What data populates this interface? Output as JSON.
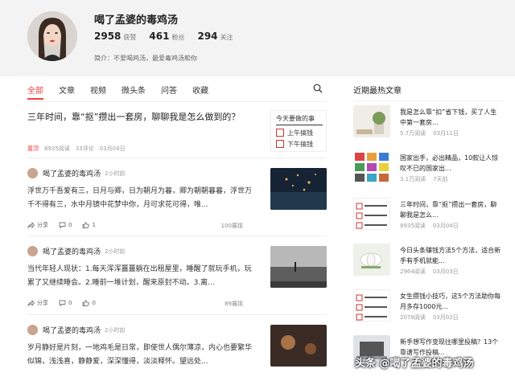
{
  "profile": {
    "name": "喝了孟婆的毒鸡汤",
    "likes": "2958",
    "likes_label": "获赞",
    "fans": "461",
    "fans_label": "粉丝",
    "follow": "294",
    "follow_label": "关注",
    "intro": "简介：不爱喝鸡汤，最爱毒鸡汤和你"
  },
  "tabs": [
    "全部",
    "文章",
    "视频",
    "微头条",
    "问答",
    "收藏"
  ],
  "feed": {
    "article": {
      "title": "三年时间，靠“抠”攒出一套房，聊聊我是怎么做到的？",
      "tag": "置顶",
      "reads": "8935阅读",
      "comments": "33评论",
      "date": "03月04日",
      "thumb_caption": "今天要做的事",
      "thumb_line1": "上午搞钱",
      "thumb_line2": "下午搞钱"
    },
    "posts": [
      {
        "author": "喝了孟婆的毒鸡汤",
        "time": "2小时前",
        "text": "浮世万千吾爱有三，日月与卿，日为朝月为暮，卿为朝朝暮暮，浮世万千不得有三，水中月镜中花梦中你，月可求花可得，唯...",
        "share": "分享",
        "comments": "0",
        "likes": "1",
        "views": "100展现"
      },
      {
        "author": "喝了孟婆的毒鸡汤",
        "time": "2小时前",
        "text": "当代年轻人现状：1.每天浑浑噩噩躺在出租屋里，睡醒了就玩手机，玩累了又继续睡会。2.睡前一堆计划，醒来原封不动。3.离...",
        "share": "分享",
        "comments": "0",
        "likes": "0",
        "views": "89展现"
      },
      {
        "author": "喝了孟婆的毒鸡汤",
        "time": "2小时前",
        "text": "岁月静好是片刻，一地鸡毛是日常，即使世人偶尔薄凉，内心也要繁华似锦，浅浅喜，静静爱，深深懂得，淡淡释怀。望远处..."
      }
    ]
  },
  "sidebar": {
    "title": "近期最热文章",
    "items": [
      {
        "text": "我是怎么靠“扣”省下钱，买了人生中第一套房...",
        "reads": "5.7万阅读",
        "date": "03月11日"
      },
      {
        "text": "国家出手，必出精品，10款让人惊叹不已的国家出...",
        "reads": "3.1万阅读",
        "date": "7天前"
      },
      {
        "text": "三年时间，靠“抠”攒出一套房，聊聊我是怎么...",
        "reads": "8935阅读",
        "date": "03月04日"
      },
      {
        "text": "今日头条赚钱方法5个方法，适合新手有手机就能...",
        "reads": "2964阅读",
        "date": "03月03日"
      },
      {
        "text": "女生攒钱小技巧，这5个方法助你每月多存1000元...",
        "reads": "2078阅读",
        "date": "03月02日"
      },
      {
        "text": "新手想写作变现往哪里投稿？13个靠谱写作投稿..."
      }
    ]
  },
  "watermark": "头条 @喝了孟婆的毒鸡汤"
}
